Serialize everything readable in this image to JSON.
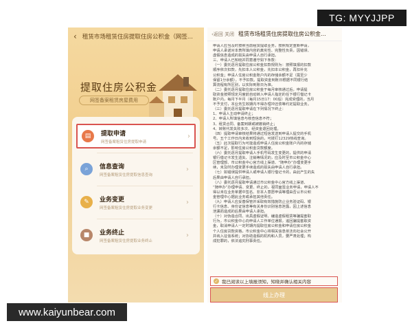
{
  "watermarks": {
    "top": "TG: MYYJJPP",
    "bottom": "www.kaiyunbear.com"
  },
  "left": {
    "nav_title": "租赁市场租赁住房提取住房公积金（网签...",
    "hero_title": "提取住房公积金",
    "hero_sub": "网签备案租赁房屋费用",
    "items": [
      {
        "title": "提取申请",
        "sub": "网签备案租赁住房提取申请",
        "icon": "document-icon",
        "color": "#e8794a"
      },
      {
        "title": "信息查询",
        "sub": "网签备案租赁住房提取信息查询",
        "icon": "search-icon",
        "color": "#7aa3d8"
      },
      {
        "title": "业务变更",
        "sub": "网签备案租赁住房提取业务变更",
        "icon": "edit-icon",
        "color": "#e8b04a"
      },
      {
        "title": "业务终止",
        "sub": "网签备案租赁住房提取业务终止",
        "icon": "stop-icon",
        "color": "#b8876a"
      }
    ]
  },
  "right": {
    "nav_left": "‹返回 关闭",
    "nav_title": "租赁市场租赁住房提取住房公积金...",
    "doc": [
      "申请人应当及时按照当前租赁提取业务，按照规定重新申请，",
      "申请人承诺对本表所填内容的真实性、完整性负责，因错误、",
      "虚假信息造成的损失由申请人自行承担。",
      "三、申请人已知晓并同意遵守如下条款：",
      "（一）委托逐月提取住房公积金扣款规则为：按照填报的扣款",
      "顺序依次扣款，先扣本人公积金，先扣本公积金，再扣补充",
      "公积金；申请人住房公积金账户内的存储余额不足（需至少",
      "保留1分余额），不予扣款。提取资金到账日根据不同银行结",
      "算流程有所区别，以实际到账日为准。",
      "（二）委托逐月提取住房公积金于每月审核通过后，申请提",
      "取资金按照规定月度前自动转入申请人指定的任下银行借记卡",
      "账户内，每月下半月（每月15日17：00后）完成受理的，当月",
      "不予支付，本业务生效期内不得办理冲还债等约定提取业务。",
      "（三）委托逐月提取申请在下列情况下终止：",
      "1、申请人主动申请终止；",
      "2、申请人所填信息与核查信息不符；",
      "3、租赁合同、备案到期或被撤销终止；",
      "4、转账代发失败多次、经资金退回处理。",
      "（四）提取申请审核结果将通过短信发送到申请人提交的手机",
      "号。五个工作日内未收到短信的，可拨打12329热线查询。",
      "（五）此次提取行为可能造成申请人住房公积金账户内的存储",
      "余额不足，影响住房公积金贷款额度。",
      "（六）委托逐月提取申请人手机号码发生变更的，提供的申请",
      "银行借记卡发生遗失、注销等情况的，应及时至市公积金中心",
      "区管理部、市公积金中心官方线上渠道、“随申办”办理变更手",
      "续，未及时办理变更手续造成的损失由申请人自行承担。",
      "（七）如错误提供申请人或申请人银行借记卡的，由此产生的失",
      "后果由申请人自行承担。",
      "（八）委托逐月提取申请通过市公积金中心官方线上渠道、",
      "“随申办”办理申请、变更、终止的，视同面签业务申请，申请人不",
      "得以未在业务单据中签名、非本人意愿申请等理由否认市公积",
      "金管理中心据此业务或承担其他责任。",
      "（九）申请人应妥善保管并采取有效措施防止业务验证码、银",
      "行卡信息、身份证信息等有关身份识别信息泄露，因上述信息",
      "泄漏而造成的后果由申请人承担。",
      "（十）对伪造合同、出具虚假证明、编造虚假租赁等骗提套取",
      "行为，市公积金中心向申请人工作单位通报，追回骗提套取资",
      "金，取消申请人一定时期内提取住房公积金和申请住房公积金",
      "个人住房贷款资格，市公积金中心将相关信息依法向社会公开",
      "并纳入征信系统；对协助造假的机构和人员，要严肃处理；构",
      "成犯罪的，依法追究刑事责任。"
    ],
    "agree_text": "我已阅读以上填报须知，知晓并确认相关内容",
    "button_label": "线上办理"
  }
}
